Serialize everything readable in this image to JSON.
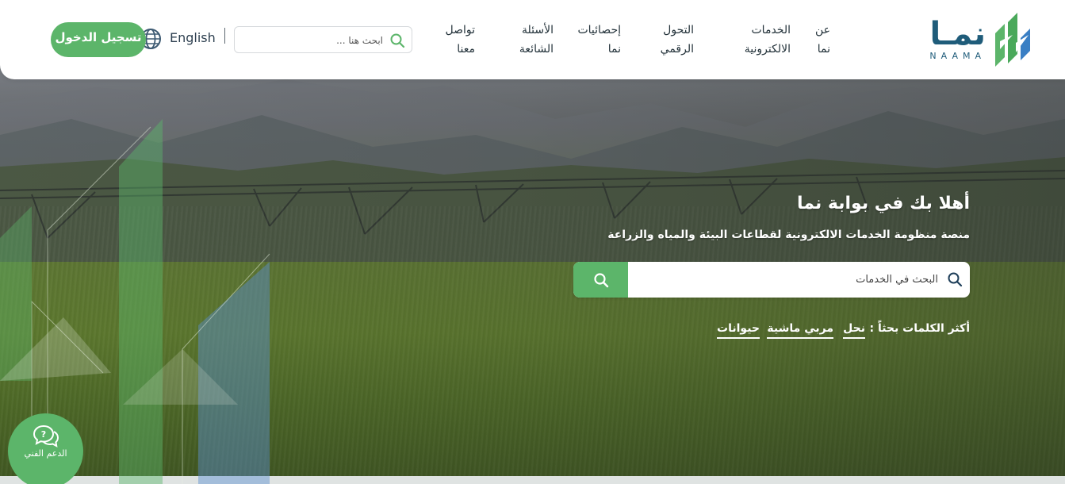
{
  "header": {
    "logo": {
      "wordmark": "نمـا",
      "latin": "NAAMA"
    },
    "nav": [
      {
        "label": "عن نما"
      },
      {
        "label": "الخدمات الالكترونية"
      },
      {
        "label": "التحول الرقمي"
      },
      {
        "label": "إحصائيات نما"
      },
      {
        "label": "الأسئلة الشائعة"
      },
      {
        "label": "تواصل معنا"
      }
    ],
    "search": {
      "placeholder": "ابحث هنا ..."
    },
    "language": "English",
    "login_label": "تسجيل الدخول"
  },
  "hero": {
    "title": "أهلا بك في بوابة نما",
    "subtitle": "منصة منظومة الخدمات الالكترونية لقطاعات البيئة والمياه والزراعة",
    "search": {
      "placeholder": "البحث في الخدمات"
    },
    "keywords_label": "أكثر الكلمات بحثاً :",
    "keywords": [
      "نحل",
      "مربي ماشية",
      "حيوانات"
    ]
  },
  "support": {
    "label": "الدعم الفني"
  },
  "colors": {
    "accent": "#5cb56a",
    "brand_blue": "#1f5c7a",
    "header_bg": "#ffffff"
  },
  "icons": {
    "search": "search-icon",
    "globe": "globe-icon",
    "support": "chat-bubbles-icon"
  }
}
